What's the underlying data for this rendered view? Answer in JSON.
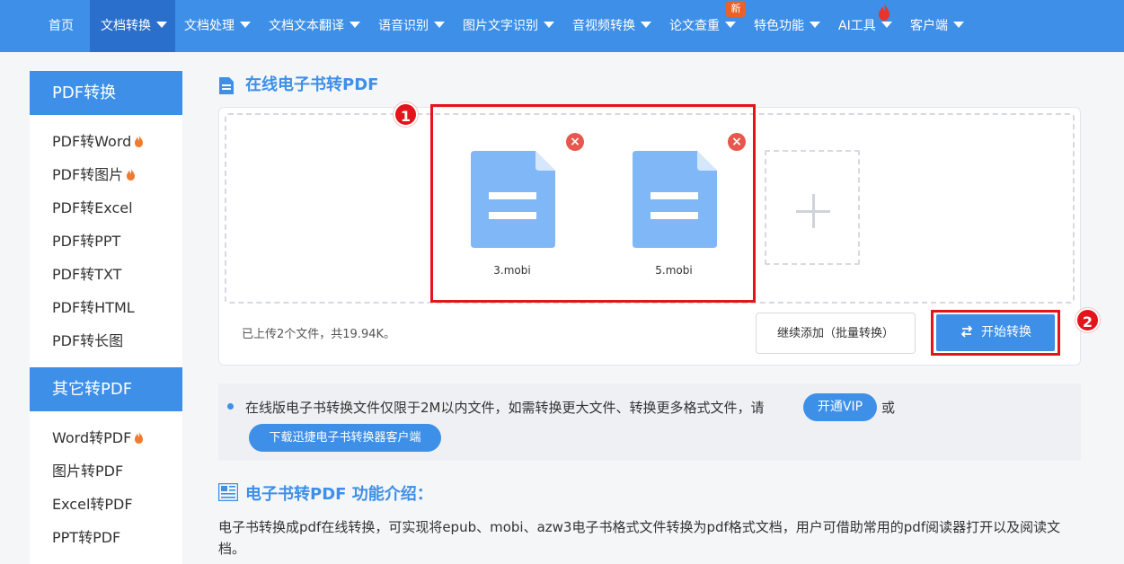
{
  "nav": {
    "items": [
      {
        "label": "首页"
      },
      {
        "label": "文档转换"
      },
      {
        "label": "文档处理"
      },
      {
        "label": "文档文本翻译"
      },
      {
        "label": "语音识别"
      },
      {
        "label": "图片文字识别"
      },
      {
        "label": "音视频转换"
      },
      {
        "label": "论文查重"
      },
      {
        "label": "特色功能"
      },
      {
        "label": "AI工具"
      },
      {
        "label": "客户端"
      }
    ],
    "new_badge": "新"
  },
  "sidebar": {
    "group1_title": "PDF转换",
    "group1_items": [
      {
        "label": "PDF转Word"
      },
      {
        "label": "PDF转图片"
      },
      {
        "label": "PDF转Excel"
      },
      {
        "label": "PDF转PPT"
      },
      {
        "label": "PDF转TXT"
      },
      {
        "label": "PDF转HTML"
      },
      {
        "label": "PDF转长图"
      }
    ],
    "group2_title": "其它转PDF",
    "group2_items": [
      {
        "label": "Word转PDF"
      },
      {
        "label": "图片转PDF"
      },
      {
        "label": "Excel转PDF"
      },
      {
        "label": "PPT转PDF"
      }
    ]
  },
  "main": {
    "title": "在线电子书转PDF",
    "files": [
      {
        "name": "3.mobi"
      },
      {
        "name": "5.mobi"
      }
    ],
    "status": "已上传2个文件，共19.94K。",
    "continue_button": "继续添加（批量转换）",
    "start_button": "开始转换",
    "annotation_1": "1",
    "annotation_2": "2"
  },
  "notice": {
    "text": "在线版电子书转换文件仅限于2M以内文件，如需转换更大文件、转换更多格式文件，请",
    "vip_button": "开通VIP",
    "or": "或",
    "download_button": "下载迅捷电子书转换器客户端"
  },
  "intro": {
    "title": "电子书转PDF 功能介绍：",
    "body": "电子书转换成pdf在线转换，可实现将epub、mobi、azw3电子书格式文件转换为pdf格式文档，用户可借助常用的pdf阅读器打开以及阅读文档。"
  },
  "colors": {
    "brand": "#3d8fe8",
    "nav_active": "#2a6fcc",
    "highlight": "#e3141b",
    "file_icon": "#7fb7f7"
  },
  "icons": {
    "title_icon": "document-icon",
    "fire": "fire-icon",
    "remove": "close-circle-icon",
    "add": "plus-icon",
    "convert": "swap-arrows-icon",
    "intro_icon": "article-icon"
  }
}
